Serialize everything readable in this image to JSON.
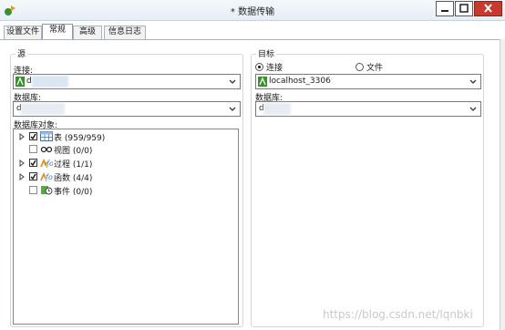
{
  "window": {
    "title": "* 数据传输",
    "min_label": "",
    "max_label": "",
    "close_label": ""
  },
  "tabs": [
    {
      "label": "设置文件"
    },
    {
      "label": "常规"
    },
    {
      "label": "高级"
    },
    {
      "label": "信息日志"
    }
  ],
  "source": {
    "title": "源",
    "connection_label": "连接:",
    "connection_value": "d",
    "database_label": "数据库:",
    "database_value": "d",
    "objects_label": "数据库对象:",
    "objects": [
      {
        "label": "表  (959/959)",
        "checked": true,
        "expandable": true,
        "icon": "table-icon"
      },
      {
        "label": "视图  (0/0)",
        "checked": false,
        "expandable": false,
        "icon": "view-icon"
      },
      {
        "label": "过程  (1/1)",
        "checked": true,
        "expandable": true,
        "icon": "procedure-icon"
      },
      {
        "label": "函数  (4/4)",
        "checked": true,
        "expandable": true,
        "icon": "function-icon"
      },
      {
        "label": "事件  (0/0)",
        "checked": false,
        "expandable": false,
        "icon": "event-icon"
      }
    ]
  },
  "target": {
    "title": "目标",
    "mode_connection": "连接",
    "mode_file": "文件",
    "selected_mode": "connection",
    "connection_value": "localhost_3306",
    "database_label": "数据库:",
    "database_value": "d"
  },
  "watermark": "https://blog.csdn.net/lqnbki",
  "colors": {
    "navicat_green": "#3a8f2f",
    "close_red": "#c73a2e",
    "checkbox_border": "#333333"
  }
}
